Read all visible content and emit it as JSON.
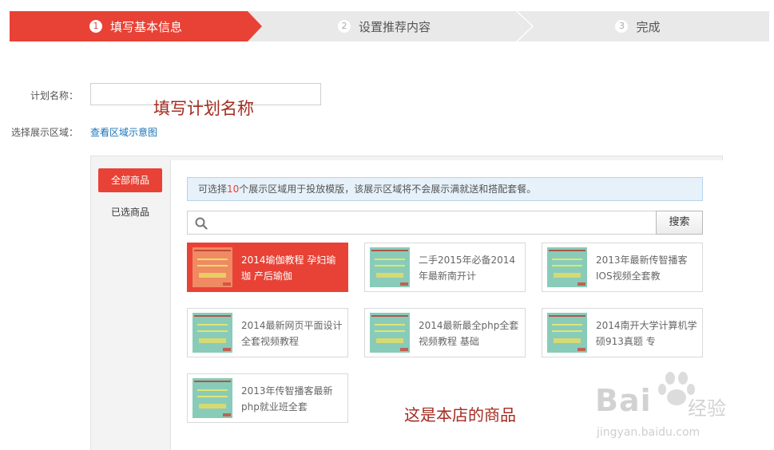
{
  "steps": [
    {
      "num": "1",
      "label": "填写基本信息"
    },
    {
      "num": "2",
      "label": "设置推荐内容"
    },
    {
      "num": "3",
      "label": "完成"
    }
  ],
  "form": {
    "plan_name_label": "计划名称：",
    "plan_name_value": "",
    "plan_name_annotation": "填写计划名称",
    "area_label": "选择展示区域：",
    "area_link": "查看区域示意图"
  },
  "panel": {
    "tabs": {
      "all": "全部商品",
      "selected": "已选商品"
    },
    "notice": {
      "prefix": "可选择",
      "count": "10",
      "suffix": "个展示区域用于投放模版，该展示区域将不会展示满就送和搭配套餐。"
    },
    "search": {
      "placeholder": "",
      "button": "搜索"
    },
    "products": [
      {
        "title": "2014瑜伽教程 孕妇瑜珈 产后瑜伽",
        "selected": true
      },
      {
        "title": "二手2015年必备2014年最新南开计",
        "selected": false
      },
      {
        "title": "2013年最新传智播客IOS视频全套教",
        "selected": false
      },
      {
        "title": "2014最新网页平面设计全套视频教程",
        "selected": false
      },
      {
        "title": "2014最新最全php全套视频教程 基础",
        "selected": false
      },
      {
        "title": "2014南开大学计算机学硕913真题 专",
        "selected": false
      },
      {
        "title": "2013年传智播客最新php就业班全套",
        "selected": false
      }
    ],
    "shop_annotation": "这是本店的商品"
  },
  "watermark": {
    "brand": "Bai",
    "brand_cn": "经验",
    "url": "jingyan.baidu.com"
  },
  "colors": {
    "accent": "#e84236",
    "link": "#1a73b8",
    "annotation": "#a32b20"
  }
}
